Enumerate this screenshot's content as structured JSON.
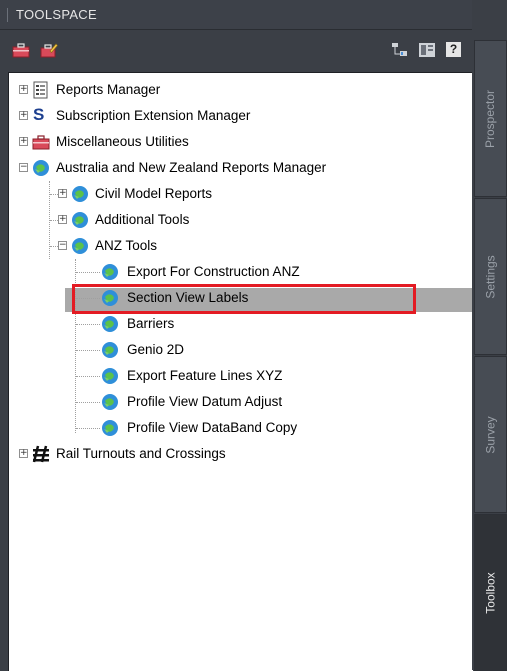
{
  "window": {
    "title": "TOOLSPACE"
  },
  "toolbar": {
    "left_icons": [
      "toolbox-icon",
      "edit-toolbox-icon"
    ],
    "right_icons": [
      "hierarchy-icon",
      "panel-icon",
      "help-icon"
    ],
    "help_glyph": "?"
  },
  "tree": {
    "items": [
      {
        "label": "Reports Manager",
        "icon": "reports-icon",
        "expander": "+"
      },
      {
        "label": "Subscription Extension Manager",
        "icon": "subscription-s-icon",
        "expander": "+",
        "icon_text": "S"
      },
      {
        "label": "Miscellaneous Utilities",
        "icon": "toolbox-icon",
        "expander": "+"
      },
      {
        "label": "Australia and New Zealand Reports Manager",
        "icon": "globe-icon",
        "expander": "−"
      },
      {
        "label": "Civil Model Reports",
        "icon": "globe-icon",
        "expander": "+"
      },
      {
        "label": "Additional Tools",
        "icon": "globe-icon",
        "expander": "+"
      },
      {
        "label": "ANZ Tools",
        "icon": "globe-icon",
        "expander": "−"
      },
      {
        "label": "Export For Construction ANZ",
        "icon": "globe-icon"
      },
      {
        "label": "Section View Labels",
        "icon": "globe-icon",
        "selected": true
      },
      {
        "label": "Barriers",
        "icon": "globe-icon"
      },
      {
        "label": "Genio 2D",
        "icon": "globe-icon"
      },
      {
        "label": "Export Feature Lines XYZ",
        "icon": "globe-icon"
      },
      {
        "label": "Profile View Datum Adjust",
        "icon": "globe-icon"
      },
      {
        "label": "Profile View DataBand Copy",
        "icon": "globe-icon"
      },
      {
        "label": "Rail Turnouts and Crossings",
        "icon": "rail-icon",
        "expander": "+"
      }
    ]
  },
  "tabs": [
    {
      "label": "Prospector",
      "active": false
    },
    {
      "label": "Settings",
      "active": false
    },
    {
      "label": "Survey",
      "active": false
    },
    {
      "label": "Toolbox",
      "active": true
    }
  ],
  "colors": {
    "highlight": "#a9a9a9",
    "annotation_box": "#e31b23",
    "panel_bg": "#3b3f46"
  }
}
